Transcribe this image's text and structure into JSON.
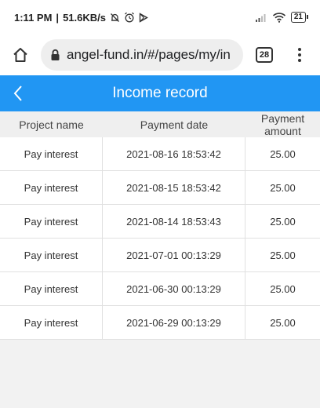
{
  "status_bar": {
    "time": "1:11 PM",
    "network_speed": "51.6KB/s",
    "battery": "21",
    "icons": [
      "bell-off-icon",
      "alarm-icon",
      "play-store-icon",
      "signal-icon",
      "wifi-icon",
      "battery-icon"
    ]
  },
  "browser": {
    "url": "angel-fund.in/#/pages/my/in",
    "tab_count": "28"
  },
  "header": {
    "title": "Income record",
    "color": "#2196f3"
  },
  "table": {
    "columns": [
      "Project name",
      "Payment date",
      "Payment amount"
    ],
    "rows": [
      {
        "project": "Pay interest",
        "date": "2021-08-16 18:53:42",
        "amount": "25.00"
      },
      {
        "project": "Pay interest",
        "date": "2021-08-15 18:53:42",
        "amount": "25.00"
      },
      {
        "project": "Pay interest",
        "date": "2021-08-14 18:53:43",
        "amount": "25.00"
      },
      {
        "project": "Pay interest",
        "date": "2021-07-01 00:13:29",
        "amount": "25.00"
      },
      {
        "project": "Pay interest",
        "date": "2021-06-30 00:13:29",
        "amount": "25.00"
      },
      {
        "project": "Pay interest",
        "date": "2021-06-29 00:13:29",
        "amount": "25.00"
      }
    ]
  }
}
